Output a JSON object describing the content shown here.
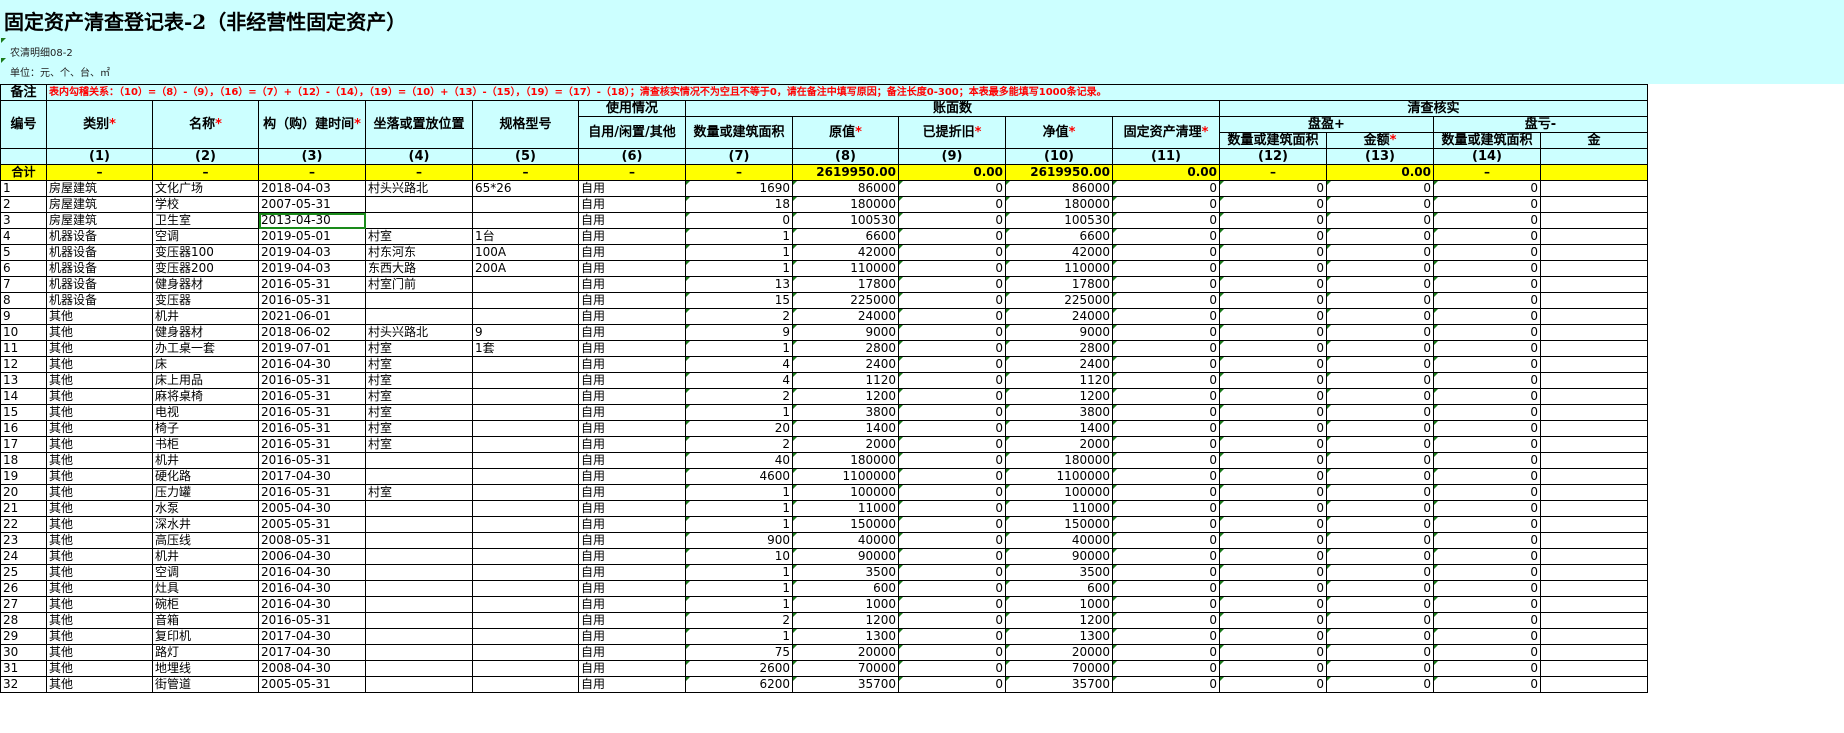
{
  "title": "固定资产清查登记表-2（非经营性固定资产）",
  "form_code": "农清明细08-2",
  "unit_line": "单位：元、个、台、㎡",
  "note": {
    "label": "备注",
    "text": "表内勾稽关系：（10）=（8）-（9），（16）=（7）+（12）-（14），（19）=（10）+（13）-（15），（19）=（17）-（18）；清查核实情况不为空且不等于0，请在备注中填写原因；备注长度0-300；本表最多能填写1000条记录。"
  },
  "headers": {
    "num": "编号",
    "category": "类别",
    "name": "名称",
    "build_time": "构（购）建时间",
    "location": "坐落或置放位置",
    "spec": "规格型号",
    "usage_group": "使用情况",
    "usage": "自用/闲置/其他",
    "book_group": "账面数",
    "qty": "数量或建筑面积",
    "orig": "原值",
    "depr": "已提折旧",
    "net": "净值",
    "cleanup": "固定资产清理",
    "verify_group": "清查核实",
    "surplus_group": "盘盈+",
    "surplus_qty": "数量或建筑面积",
    "surplus_amt": "金额",
    "loss_group": "盘亏-",
    "loss_qty": "数量或建筑面积",
    "loss_amt": "金"
  },
  "required_mark": "*",
  "col_nums": [
    "(1)",
    "(2)",
    "(3)",
    "(4)",
    "(5)",
    "(6)",
    "(7)",
    "(8)",
    "(9)",
    "(10)",
    "(11)",
    "(12)",
    "(13)",
    "(14)"
  ],
  "totals": {
    "label": "合计",
    "dash": "–",
    "orig": "2619950.00",
    "depr": "0.00",
    "net": "2619950.00",
    "cleanup": "0.00",
    "surplus_amt": "0.00"
  },
  "rows": [
    [
      "1",
      "房屋建筑",
      "文化广场",
      "2018-04-03",
      "村头兴路北",
      "65*26",
      "自用",
      "1690",
      "86000",
      "0",
      "86000",
      "0",
      "0",
      "0",
      "0"
    ],
    [
      "2",
      "房屋建筑",
      "学校",
      "2007-05-31",
      "",
      "",
      "自用",
      "18",
      "180000",
      "0",
      "180000",
      "0",
      "0",
      "0",
      "0"
    ],
    [
      "3",
      "房屋建筑",
      "卫生室",
      "2013-04-30",
      "",
      "",
      "自用",
      "0",
      "100530",
      "0",
      "100530",
      "0",
      "0",
      "0",
      "0"
    ],
    [
      "4",
      "机器设备",
      "空调",
      "2019-05-01",
      "村室",
      "1台",
      "自用",
      "1",
      "6600",
      "0",
      "6600",
      "0",
      "0",
      "0",
      "0"
    ],
    [
      "5",
      "机器设备",
      "变压器100",
      "2019-04-03",
      "村东河东",
      "100A",
      "自用",
      "1",
      "42000",
      "0",
      "42000",
      "0",
      "0",
      "0",
      "0"
    ],
    [
      "6",
      "机器设备",
      "变压器200",
      "2019-04-03",
      "东西大路",
      "200A",
      "自用",
      "1",
      "110000",
      "0",
      "110000",
      "0",
      "0",
      "0",
      "0"
    ],
    [
      "7",
      "机器设备",
      "健身器材",
      "2016-05-31",
      "村室门前",
      "",
      "自用",
      "13",
      "17800",
      "0",
      "17800",
      "0",
      "0",
      "0",
      "0"
    ],
    [
      "8",
      "机器设备",
      "变压器",
      "2016-05-31",
      "",
      "",
      "自用",
      "15",
      "225000",
      "0",
      "225000",
      "0",
      "0",
      "0",
      "0"
    ],
    [
      "9",
      "其他",
      "机井",
      "2021-06-01",
      "",
      "",
      "自用",
      "2",
      "24000",
      "0",
      "24000",
      "0",
      "0",
      "0",
      "0"
    ],
    [
      "10",
      "其他",
      "健身器材",
      "2018-06-02",
      "村头兴路北",
      "9",
      "自用",
      "9",
      "9000",
      "0",
      "9000",
      "0",
      "0",
      "0",
      "0"
    ],
    [
      "11",
      "其他",
      "办工桌一套",
      "2019-07-01",
      "村室",
      "1套",
      "自用",
      "1",
      "2800",
      "0",
      "2800",
      "0",
      "0",
      "0",
      "0"
    ],
    [
      "12",
      "其他",
      "床",
      "2016-04-30",
      "村室",
      "",
      "自用",
      "4",
      "2400",
      "0",
      "2400",
      "0",
      "0",
      "0",
      "0"
    ],
    [
      "13",
      "其他",
      "床上用品",
      "2016-05-31",
      "村室",
      "",
      "自用",
      "4",
      "1120",
      "0",
      "1120",
      "0",
      "0",
      "0",
      "0"
    ],
    [
      "14",
      "其他",
      "麻将桌椅",
      "2016-05-31",
      "村室",
      "",
      "自用",
      "2",
      "1200",
      "0",
      "1200",
      "0",
      "0",
      "0",
      "0"
    ],
    [
      "15",
      "其他",
      "电视",
      "2016-05-31",
      "村室",
      "",
      "自用",
      "1",
      "3800",
      "0",
      "3800",
      "0",
      "0",
      "0",
      "0"
    ],
    [
      "16",
      "其他",
      "椅子",
      "2016-05-31",
      "村室",
      "",
      "自用",
      "20",
      "1400",
      "0",
      "1400",
      "0",
      "0",
      "0",
      "0"
    ],
    [
      "17",
      "其他",
      "书柜",
      "2016-05-31",
      "村室",
      "",
      "自用",
      "2",
      "2000",
      "0",
      "2000",
      "0",
      "0",
      "0",
      "0"
    ],
    [
      "18",
      "其他",
      "机井",
      "2016-05-31",
      "",
      "",
      "自用",
      "40",
      "180000",
      "0",
      "180000",
      "0",
      "0",
      "0",
      "0"
    ],
    [
      "19",
      "其他",
      "硬化路",
      "2017-04-30",
      "",
      "",
      "自用",
      "4600",
      "1100000",
      "0",
      "1100000",
      "0",
      "0",
      "0",
      "0"
    ],
    [
      "20",
      "其他",
      "压力罐",
      "2016-05-31",
      "村室",
      "",
      "自用",
      "1",
      "100000",
      "0",
      "100000",
      "0",
      "0",
      "0",
      "0"
    ],
    [
      "21",
      "其他",
      "水泵",
      "2005-04-30",
      "",
      "",
      "自用",
      "1",
      "11000",
      "0",
      "11000",
      "0",
      "0",
      "0",
      "0"
    ],
    [
      "22",
      "其他",
      "深水井",
      "2005-05-31",
      "",
      "",
      "自用",
      "1",
      "150000",
      "0",
      "150000",
      "0",
      "0",
      "0",
      "0"
    ],
    [
      "23",
      "其他",
      "高压线",
      "2008-05-31",
      "",
      "",
      "自用",
      "900",
      "40000",
      "0",
      "40000",
      "0",
      "0",
      "0",
      "0"
    ],
    [
      "24",
      "其他",
      "机井",
      "2006-04-30",
      "",
      "",
      "自用",
      "10",
      "90000",
      "0",
      "90000",
      "0",
      "0",
      "0",
      "0"
    ],
    [
      "25",
      "其他",
      "空调",
      "2016-04-30",
      "",
      "",
      "自用",
      "1",
      "3500",
      "0",
      "3500",
      "0",
      "0",
      "0",
      "0"
    ],
    [
      "26",
      "其他",
      "灶具",
      "2016-04-30",
      "",
      "",
      "自用",
      "1",
      "600",
      "0",
      "600",
      "0",
      "0",
      "0",
      "0"
    ],
    [
      "27",
      "其他",
      "碗柜",
      "2016-04-30",
      "",
      "",
      "自用",
      "1",
      "1000",
      "0",
      "1000",
      "0",
      "0",
      "0",
      "0"
    ],
    [
      "28",
      "其他",
      "音箱",
      "2016-05-31",
      "",
      "",
      "自用",
      "2",
      "1200",
      "0",
      "1200",
      "0",
      "0",
      "0",
      "0"
    ],
    [
      "29",
      "其他",
      "复印机",
      "2017-04-30",
      "",
      "",
      "自用",
      "1",
      "1300",
      "0",
      "1300",
      "0",
      "0",
      "0",
      "0"
    ],
    [
      "30",
      "其他",
      "路灯",
      "2017-04-30",
      "",
      "",
      "自用",
      "75",
      "20000",
      "0",
      "20000",
      "0",
      "0",
      "0",
      "0"
    ],
    [
      "31",
      "其他",
      "地埋线",
      "2008-04-30",
      "",
      "",
      "自用",
      "2600",
      "70000",
      "0",
      "70000",
      "0",
      "0",
      "0",
      "0"
    ],
    [
      "32",
      "其他",
      "街管道",
      "2005-05-31",
      "",
      "",
      "自用",
      "6200",
      "35700",
      "0",
      "35700",
      "0",
      "0",
      "0",
      "0"
    ]
  ]
}
